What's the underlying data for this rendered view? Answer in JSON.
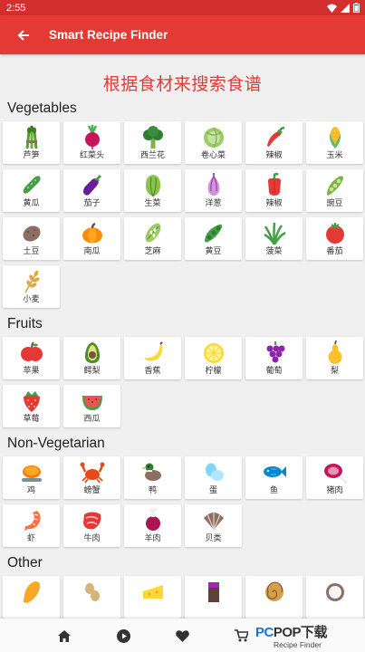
{
  "status_bar": {
    "time": "2:55"
  },
  "app_bar": {
    "title": "Smart Recipe Finder"
  },
  "headline": "根据食材来搜索食谱",
  "sections": [
    {
      "title": "Vegetables",
      "items": [
        {
          "label": "芦笋",
          "icon": "asparagus-icon"
        },
        {
          "label": "红菜头",
          "icon": "beetroot-icon"
        },
        {
          "label": "西兰花",
          "icon": "broccoli-icon"
        },
        {
          "label": "卷心菜",
          "icon": "cabbage-icon"
        },
        {
          "label": "辣椒",
          "icon": "chili-icon"
        },
        {
          "label": "玉米",
          "icon": "corn-icon"
        },
        {
          "label": "黄瓜",
          "icon": "cucumber-icon"
        },
        {
          "label": "茄子",
          "icon": "eggplant-icon"
        },
        {
          "label": "生菜",
          "icon": "lettuce-icon"
        },
        {
          "label": "洋葱",
          "icon": "onion-icon"
        },
        {
          "label": "辣椒",
          "icon": "bell-pepper-icon"
        },
        {
          "label": "豌豆",
          "icon": "peas-icon"
        },
        {
          "label": "土豆",
          "icon": "potato-icon"
        },
        {
          "label": "南瓜",
          "icon": "pumpkin-icon"
        },
        {
          "label": "芝麻",
          "icon": "sesame-icon"
        },
        {
          "label": "黄豆",
          "icon": "soybean-icon"
        },
        {
          "label": "菠菜",
          "icon": "spinach-icon"
        },
        {
          "label": "番茄",
          "icon": "tomato-icon"
        },
        {
          "label": "小麦",
          "icon": "wheat-icon"
        }
      ]
    },
    {
      "title": "Fruits",
      "items": [
        {
          "label": "苹果",
          "icon": "apple-icon"
        },
        {
          "label": "鳄梨",
          "icon": "avocado-icon"
        },
        {
          "label": "香蕉",
          "icon": "banana-icon"
        },
        {
          "label": "柠檬",
          "icon": "lemon-icon"
        },
        {
          "label": "葡萄",
          "icon": "grapes-icon"
        },
        {
          "label": "梨",
          "icon": "pear-icon"
        },
        {
          "label": "草莓",
          "icon": "strawberry-icon"
        },
        {
          "label": "西瓜",
          "icon": "watermelon-icon"
        }
      ]
    },
    {
      "title": "Non-Vegetarian",
      "items": [
        {
          "label": "鸡",
          "icon": "chicken-icon"
        },
        {
          "label": "螃蟹",
          "icon": "crab-icon"
        },
        {
          "label": "鸭",
          "icon": "duck-icon"
        },
        {
          "label": "蛋",
          "icon": "egg-icon"
        },
        {
          "label": "鱼",
          "icon": "fish-icon"
        },
        {
          "label": "猪肉",
          "icon": "pork-icon"
        },
        {
          "label": "虾",
          "icon": "shrimp-icon"
        },
        {
          "label": "牛肉",
          "icon": "beef-icon"
        },
        {
          "label": "羊肉",
          "icon": "mutton-icon"
        },
        {
          "label": "贝类",
          "icon": "shellfish-icon"
        }
      ]
    },
    {
      "title": "Other",
      "items": [
        {
          "label": "",
          "icon": "bread-icon"
        },
        {
          "label": "",
          "icon": "peanut-icon"
        },
        {
          "label": "",
          "icon": "cheese-icon"
        },
        {
          "label": "",
          "icon": "chocolate-icon"
        },
        {
          "label": "",
          "icon": "cinnamon-roll-icon"
        },
        {
          "label": "",
          "icon": "coconut-icon"
        }
      ]
    }
  ],
  "bottom_nav": [
    {
      "name": "home",
      "icon": "home-icon"
    },
    {
      "name": "play",
      "icon": "play-icon"
    },
    {
      "name": "favorites",
      "icon": "heart-icon"
    },
    {
      "name": "cart",
      "icon": "cart-icon"
    }
  ],
  "watermark": {
    "brand_a": "PC",
    "brand_b": "POP",
    "brand_c": "下载",
    "sub": "Recipe Finder"
  },
  "colors": {
    "app_bar": "#e53935",
    "status_bar": "#d32f2f",
    "headline": "#e53935",
    "background": "#f0f0f0"
  }
}
